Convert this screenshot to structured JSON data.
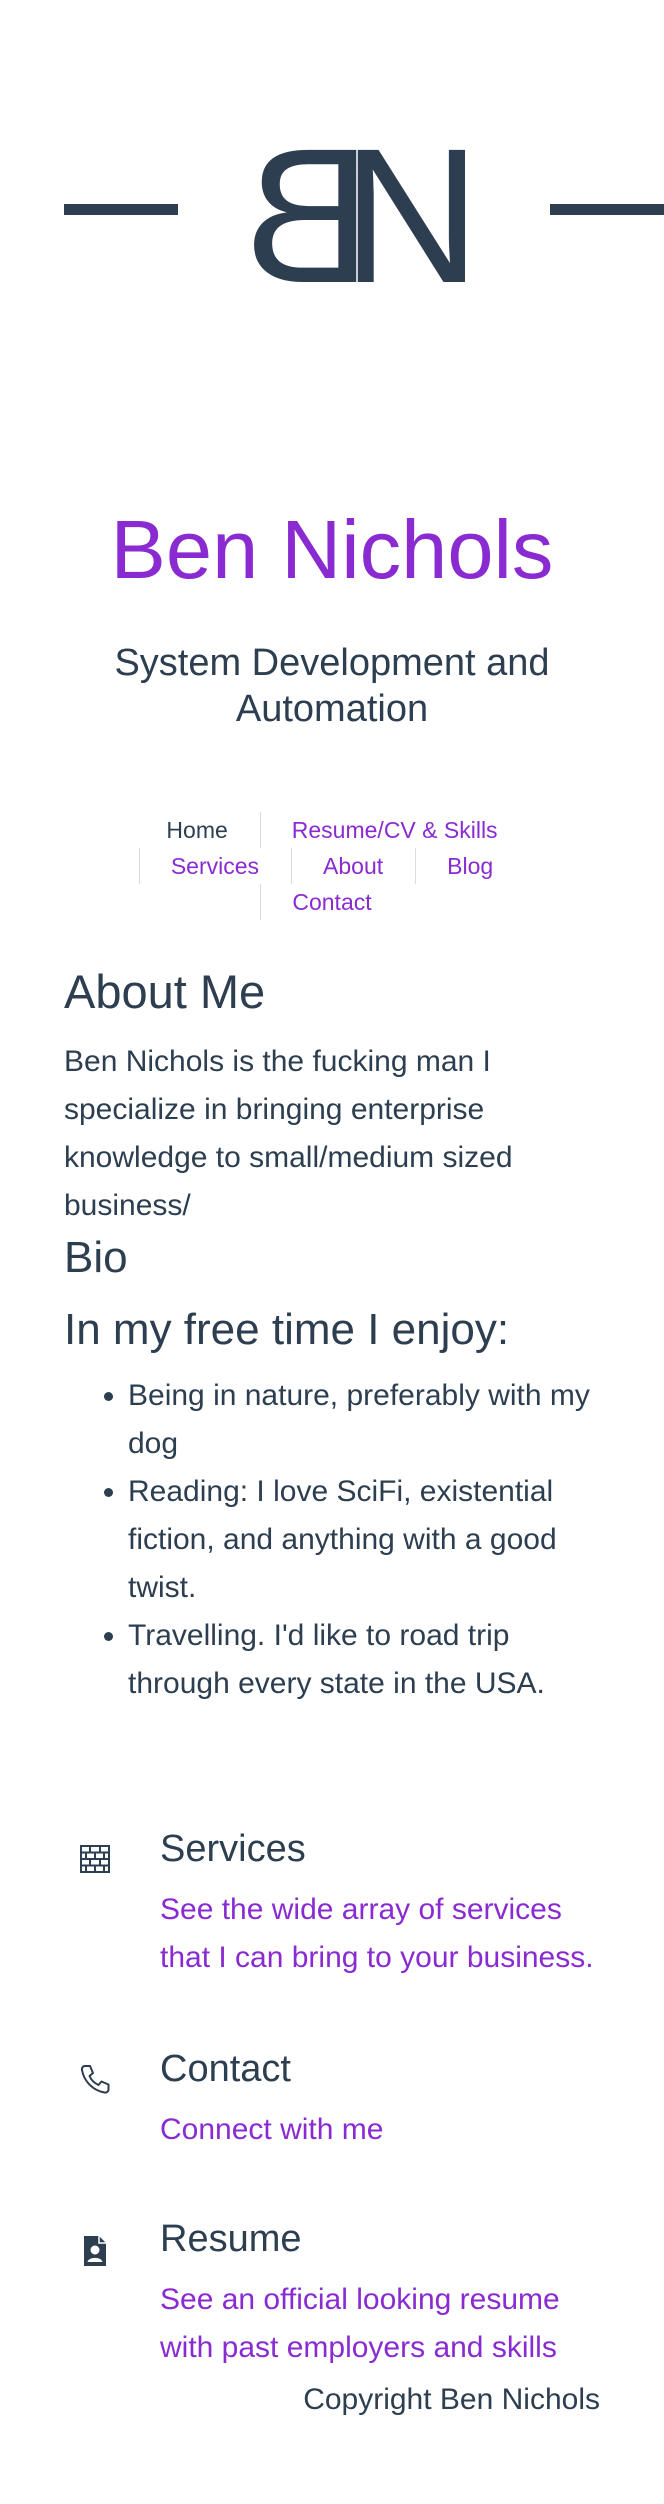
{
  "logo": {
    "left_letter": "B",
    "right_letter": "N"
  },
  "site": {
    "title": "Ben Nichols",
    "tagline": "System Development and Automation"
  },
  "nav": {
    "rows": [
      [
        {
          "label": "Home",
          "current": true
        },
        {
          "label": "Resume/CV & Skills"
        }
      ],
      [
        {
          "label": "Services"
        },
        {
          "label": "About"
        },
        {
          "label": "Blog"
        }
      ],
      [
        {
          "label": "Contact"
        }
      ]
    ]
  },
  "about": {
    "heading": "About Me",
    "text": "Ben Nichols is the fucking man I specialize in bringing enterprise knowledge to small/medium sized business/",
    "bio_heading": "Bio",
    "free_time_heading": "In my free time I enjoy:",
    "hobbies": [
      "Being in nature, preferably with my dog",
      "Reading: I love SciFi, existential fiction, and anything with a good twist.",
      "Travelling. I'd like to road trip through every state in the USA."
    ]
  },
  "features": [
    {
      "icon": "bricks-icon",
      "title": "Services",
      "link": "See the wide array of services that I can bring to your business."
    },
    {
      "icon": "phone-icon",
      "title": "Contact",
      "link": "Connect with me"
    },
    {
      "icon": "resume-icon",
      "title": "Resume",
      "link": "See an official looking resume with past employers and skills"
    }
  ],
  "footer": {
    "copyright": "Copyright Ben Nichols"
  },
  "colors": {
    "accent": "#8a2bd2",
    "text": "#2c3e50"
  }
}
